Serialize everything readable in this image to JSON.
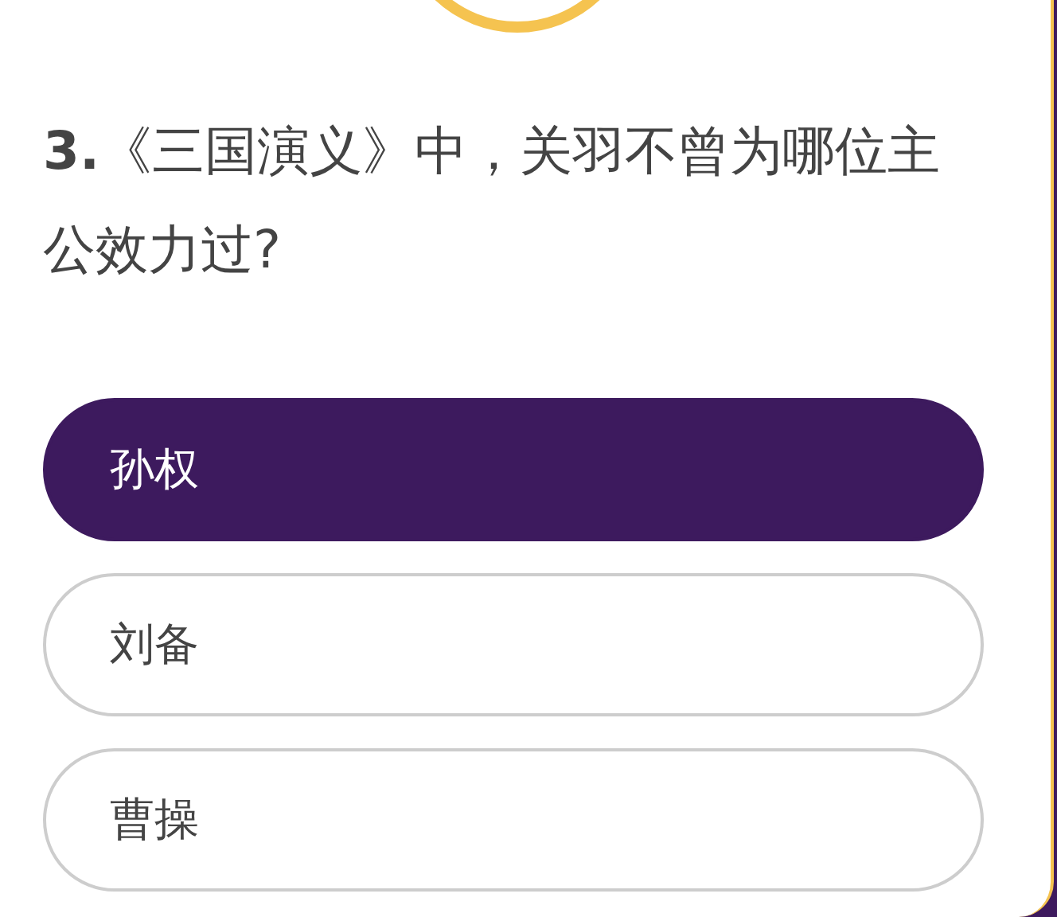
{
  "question": "**3.**《三国演义》中，关羽不曾为哪位主公效力过?",
  "options": [
    {
      "label": "孙权",
      "selected": true
    },
    {
      "label": "刘备",
      "selected": false
    },
    {
      "label": "曹操",
      "selected": false
    }
  ]
}
